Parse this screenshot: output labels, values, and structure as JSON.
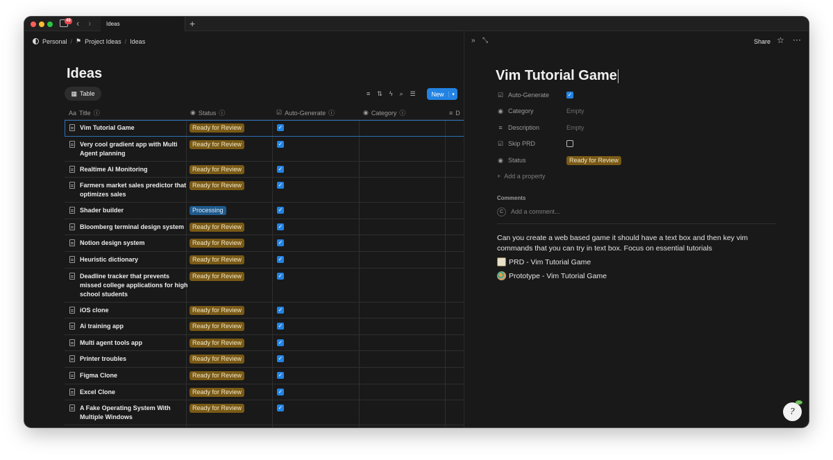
{
  "window": {
    "badge": "49",
    "tab_title": "Ideas"
  },
  "breadcrumb": {
    "items": [
      "Personal",
      "Project Ideas",
      "Ideas"
    ]
  },
  "page": {
    "title": "Ideas",
    "view_tab": "Table",
    "new_button": "New"
  },
  "columns": [
    "Title",
    "Status",
    "Auto-Generate",
    "Category",
    "D"
  ],
  "rows": [
    {
      "title": [
        "Vim Tutorial Game"
      ],
      "status": "Ready for Review",
      "auto": true
    },
    {
      "title": [
        "Very cool gradient app with Multi",
        "Agent planning"
      ],
      "status": "Ready for Review",
      "auto": true
    },
    {
      "title": [
        "Realtime AI Monitoring"
      ],
      "status": "Ready for Review",
      "auto": true
    },
    {
      "title": [
        "Farmers market sales predictor that",
        "optimizes sales"
      ],
      "status": "Ready for Review",
      "auto": true
    },
    {
      "title": [
        "Shader builder"
      ],
      "status": "Processing",
      "auto": true
    },
    {
      "title": [
        "Bloomberg terminal design system"
      ],
      "status": "Ready for Review",
      "auto": true
    },
    {
      "title": [
        "Notion design system"
      ],
      "status": "Ready for Review",
      "auto": true
    },
    {
      "title": [
        "Heuristic dictionary"
      ],
      "status": "Ready for Review",
      "auto": true
    },
    {
      "title": [
        "Deadline tracker that prevents",
        "missed college applications for high",
        "school students"
      ],
      "status": "Ready for Review",
      "auto": true
    },
    {
      "title": [
        "iOS clone"
      ],
      "status": "Ready for Review",
      "auto": true
    },
    {
      "title": [
        "Ai training app"
      ],
      "status": "Ready for Review",
      "auto": true
    },
    {
      "title": [
        "Multi agent tools app"
      ],
      "status": "Ready for Review",
      "auto": true
    },
    {
      "title": [
        "Printer troubles"
      ],
      "status": "Ready for Review",
      "auto": true
    },
    {
      "title": [
        "Figma Clone"
      ],
      "status": "Ready for Review",
      "auto": true
    },
    {
      "title": [
        "Excel Clone"
      ],
      "status": "Ready for Review",
      "auto": true
    },
    {
      "title": [
        "A Fake Operating System With",
        "Multiple Windows"
      ],
      "status": "Ready for Review",
      "auto": true
    }
  ],
  "panel": {
    "share": "Share",
    "title": "Vim Tutorial Game",
    "props": {
      "auto_generate": "Auto-Generate",
      "category": "Category",
      "category_value": "Empty",
      "description": "Description",
      "description_value": "Empty",
      "skip_prd": "Skip PRD",
      "status": "Status",
      "status_value": "Ready for Review"
    },
    "add_property": "Add a property",
    "comments_label": "Comments",
    "comment_avatar": "C",
    "comment_placeholder": "Add a comment...",
    "body_text": "Can you create a web based game it should have a text box and then key vim commands that you can try in text box. Focus on essential tutorials",
    "links": [
      "PRD - Vim Tutorial Game",
      "Prototype - Vim Tutorial Game"
    ]
  }
}
